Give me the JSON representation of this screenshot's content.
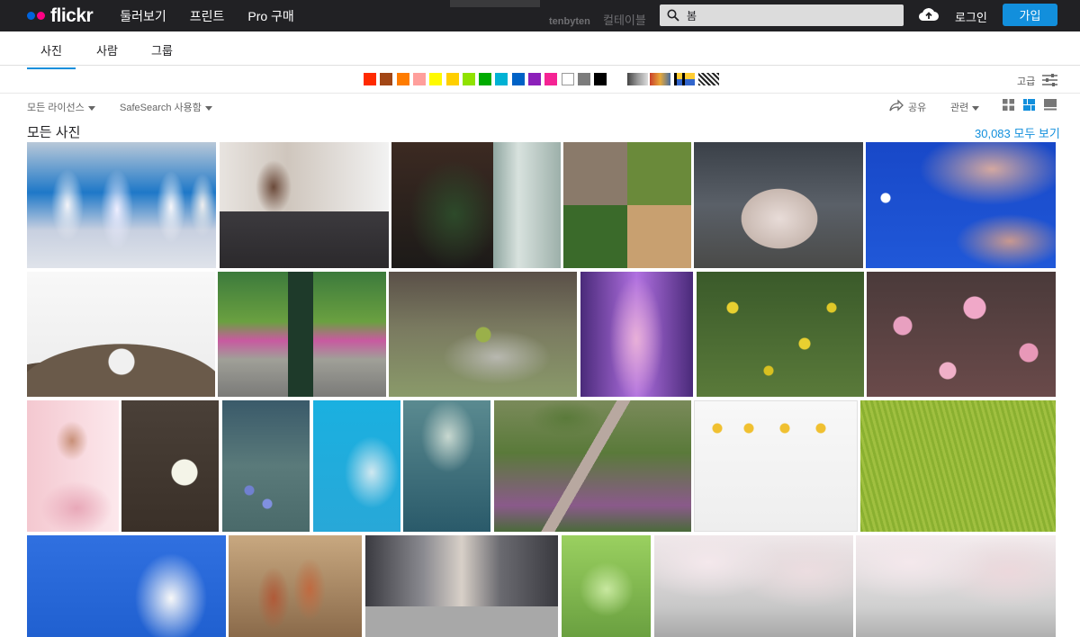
{
  "header": {
    "logo": "flickr",
    "nav": [
      "둘러보기",
      "프린트",
      "Pro 구매"
    ],
    "search_value": "봄",
    "login": "로그인",
    "join": "가입",
    "ghost_user": "tenbyten",
    "ghost_text": "컬테이블 다"
  },
  "tabs": [
    "사진",
    "사람",
    "그룹"
  ],
  "color_filters": [
    "#ff2a00",
    "#a24615",
    "#ff7c00",
    "#ff9f9c",
    "#fffa00",
    "#ffcf00",
    "#90e200",
    "#00ab00",
    "#00b2d4",
    "#0062c6",
    "#8c20ba",
    "#f52394",
    "#ffffff",
    "#7c7c7c",
    "#000000"
  ],
  "advanced": "고급",
  "filters": {
    "license": "모든 라이선스",
    "safesearch": "SafeSearch 사용함",
    "share": "공유",
    "sort": "관련"
  },
  "page_title": "모든 사진",
  "view_all": "30,083 모두 보기",
  "icons": [
    "search-icon",
    "cloud-upload-icon",
    "filter-sliders-icon",
    "share-icon",
    "grid-view-icon",
    "justified-view-icon",
    "detail-view-icon"
  ]
}
